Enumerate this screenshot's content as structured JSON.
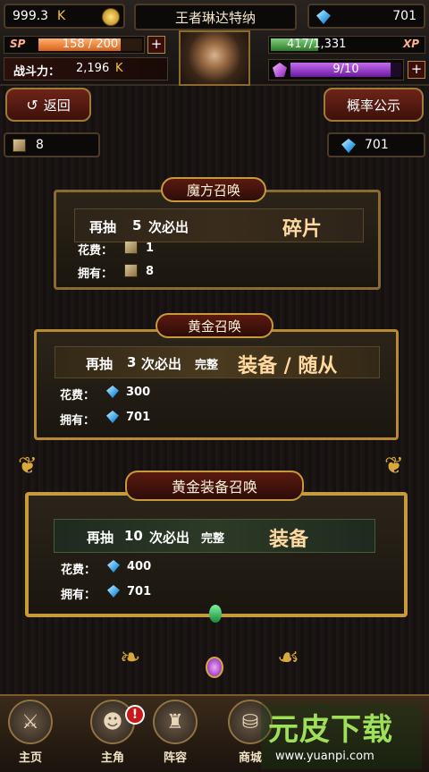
{
  "top": {
    "gold": "999.3",
    "gold_unit": "K",
    "player_name": "王者琳达特纳",
    "diamonds": "701",
    "sp_label": "SP",
    "sp": "158 / 200",
    "sp_fraction": 0.79,
    "xp": "417/1,331",
    "xp_label": "XP",
    "xp_fraction": 0.31,
    "power_label": "战斗力：",
    "power": "2,196",
    "power_unit": "K",
    "energy": "9/10",
    "energy_fraction": 0.9,
    "plus": "+"
  },
  "nav": {
    "back": "返回",
    "prob": "概率公示"
  },
  "res": {
    "cubes": "8",
    "diamonds": "701"
  },
  "cards": [
    {
      "title": "魔方召唤",
      "line_prefix": "再抽",
      "count": "5",
      "line_suffix": "次必出",
      "line_extra": "",
      "reward": "碎片",
      "cost_label": "花费：",
      "cost": "1",
      "own_label": "拥有：",
      "own": "8",
      "currency": "cube"
    },
    {
      "title": "黄金召唤",
      "line_prefix": "再抽",
      "count": "3",
      "line_suffix": "次必出",
      "line_extra": "完整",
      "reward": "装备 / 随从",
      "cost_label": "花费：",
      "cost": "300",
      "own_label": "拥有：",
      "own": "701",
      "currency": "gem"
    },
    {
      "title": "黄金装备召唤",
      "line_prefix": "再抽",
      "count": "10",
      "line_suffix": "次必出",
      "line_extra": "完整",
      "reward": "装备",
      "cost_label": "花费：",
      "cost": "400",
      "own_label": "拥有：",
      "own": "701",
      "currency": "gem"
    }
  ],
  "tabs": [
    "主页",
    "主角",
    "阵容",
    "商城"
  ],
  "badge": "!",
  "watermark": {
    "main": "元皮下载",
    "url": "www.yuanpi.com"
  }
}
